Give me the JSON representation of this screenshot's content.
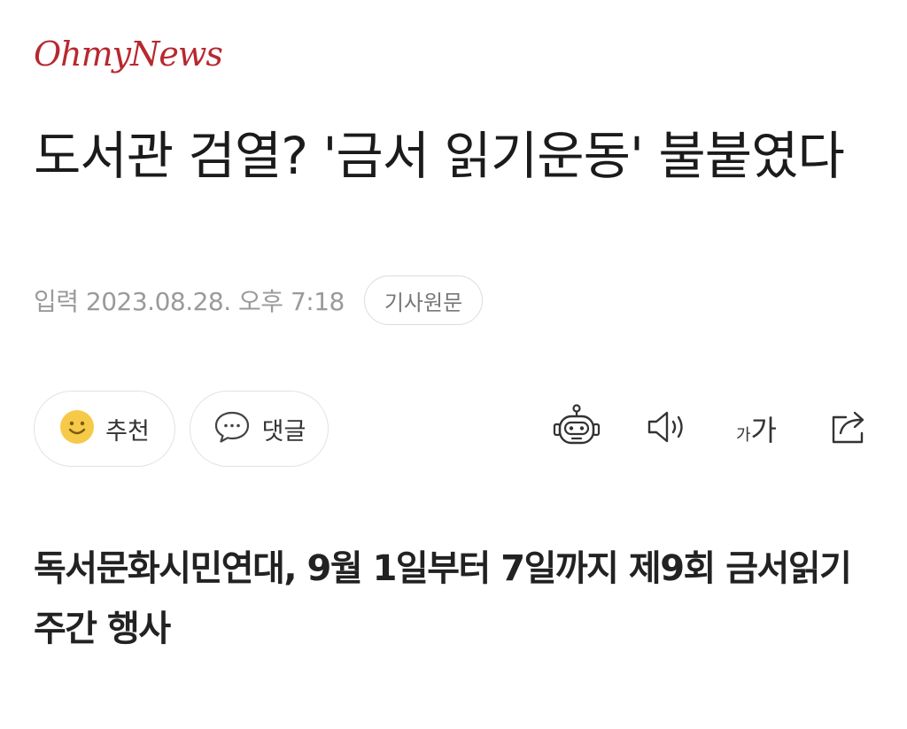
{
  "header": {
    "logo": "OhmyNews"
  },
  "article": {
    "headline": "도서관 검열? '금서 읽기운동' 불붙였다",
    "published": "입력 2023.08.28. 오후 7:18",
    "original_link_label": "기사원문",
    "subheadline": "독서문화시민연대, 9월 1일부터 7일까지 제9회 금서읽기주간 행사"
  },
  "actions": {
    "recommend_label": "추천",
    "comment_label": "댓글",
    "font_size_small": "가",
    "font_size_large": "가"
  },
  "colors": {
    "brand": "#b8282f",
    "smiley": "#f7c948",
    "meta_text": "#9a9a9a"
  }
}
